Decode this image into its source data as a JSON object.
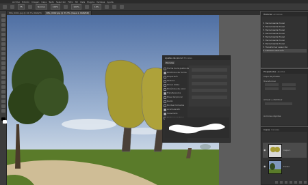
{
  "app": {
    "logo": "Ps",
    "logo_color": "#1473e6"
  },
  "menu": [
    "Archivo",
    "Edición",
    "Imagen",
    "Capa",
    "Texto",
    "Selección",
    "Filtro",
    "3D",
    "Vista",
    "Plugins",
    "Ventana",
    "Ayuda"
  ],
  "options": {
    "size": "75",
    "mode": "Normal",
    "opacity": "100%",
    "flow": "100%",
    "smoothing": "10%"
  },
  "tabs": [
    {
      "label": "IMG_0001.jpg @ 16,7% (RGB/8)",
      "active": false
    },
    {
      "label": "IMG_0002.jpg @ 33,3% (Capa 1, RGB/8#)",
      "active": true
    }
  ],
  "properties_dialog": {
    "title": "Ajustes de pincel",
    "tab2": "Pinceles",
    "button": "Pinceles",
    "options": [
      {
        "label": "Forma de la punta del pincel",
        "checked": false
      },
      {
        "label": "Dinámica de forma",
        "checked": true
      },
      {
        "label": "Dispersión",
        "checked": false
      },
      {
        "label": "Textura",
        "checked": false
      },
      {
        "label": "Pincel doble",
        "checked": false
      },
      {
        "label": "Dinámica de color",
        "checked": false
      },
      {
        "label": "Transferencia",
        "checked": true
      },
      {
        "label": "Pose del pincel",
        "checked": false
      },
      {
        "label": "Ruido",
        "checked": false
      },
      {
        "label": "Bordes húmedos",
        "checked": false
      },
      {
        "label": "Acumulación",
        "checked": true
      },
      {
        "label": "Suavizado",
        "checked": true
      },
      {
        "label": "Proteger textura",
        "checked": false
      }
    ],
    "stroke_color": "#ffffff"
  },
  "history": {
    "title": "Historial",
    "tab2": "Acciones",
    "items": [
      {
        "label": "Herramienta Pincel",
        "selected": false
      },
      {
        "label": "Herramienta Pincel",
        "selected": false
      },
      {
        "label": "Herramienta Pincel",
        "selected": false
      },
      {
        "label": "Herramienta Pincel",
        "selected": false
      },
      {
        "label": "Herramienta Pincel",
        "selected": false
      },
      {
        "label": "Herramienta Pincel",
        "selected": false
      },
      {
        "label": "Herramienta Pincel",
        "selected": false
      },
      {
        "label": "Transformar selección",
        "selected": false
      },
      {
        "label": "Cambiar selección",
        "selected": true
      }
    ]
  },
  "properties": {
    "title": "Propiedades",
    "tab2": "Ajustes",
    "section": "Capa de píxeles",
    "transform": "Transformar",
    "align": "Alinear y distribuir",
    "quick": "Acciones rápidas"
  },
  "layers": {
    "title": "Capas",
    "tab2": "Canales",
    "items": [
      {
        "name": "Capa 1",
        "selected": true
      },
      {
        "name": "Fondo",
        "selected": false
      }
    ]
  },
  "canvas_colors": {
    "sky": "#6f8cb8",
    "grass": "#5b7a2c",
    "road": "#c9b591",
    "paint": "#a59a32"
  }
}
